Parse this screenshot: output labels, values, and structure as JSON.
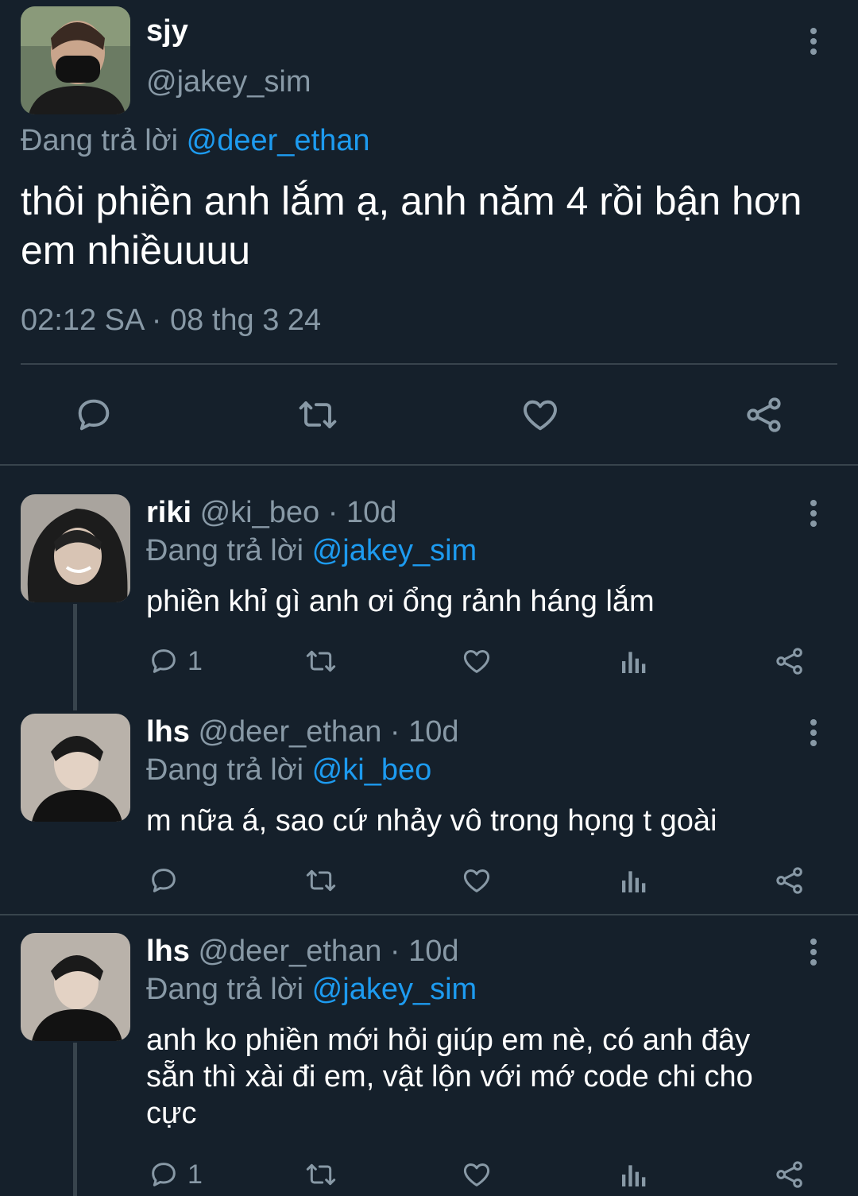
{
  "main_tweet": {
    "display_name": "sjy",
    "handle": "@jakey_sim",
    "reply_prefix": "Đang trả lời",
    "reply_to": "@deer_ethan",
    "text": "thôi phiền anh lắm ạ, anh năm 4 rồi bận hơn em nhiềuuuu",
    "timestamp": "02:12 SA · 08 thg 3 24"
  },
  "replies": [
    {
      "display_name": "riki",
      "handle": "@ki_beo",
      "time": "· 10d",
      "reply_prefix": "Đang trả lời",
      "reply_to": "@jakey_sim",
      "text_lines": [
        "phiền khỉ gì anh ơi ổng rảnh háng lắm"
      ],
      "reply_count": "1"
    },
    {
      "display_name": "lhs",
      "handle": "@deer_ethan",
      "time": "· 10d",
      "reply_prefix": "Đang trả lời",
      "reply_to": "@ki_beo",
      "text_lines": [
        "m nữa á, sao cứ nhảy vô trong họng t goài"
      ],
      "reply_count": ""
    },
    {
      "display_name": "lhs",
      "handle": "@deer_ethan",
      "time": "· 10d",
      "reply_prefix": "Đang trả lời",
      "reply_to": "@jakey_sim",
      "text_lines": [
        "anh ko phiền mới hỏi giúp em nè, có anh đây",
        "sẵn thì xài đi em, vật lộn với mớ code chi cho",
        "cực"
      ],
      "reply_count": "1"
    }
  ],
  "icons": {
    "reply": "reply-icon",
    "retweet": "retweet-icon",
    "like": "heart-icon",
    "views": "views-icon",
    "share": "share-icon",
    "more": "more-vertical-icon"
  },
  "colors": {
    "background": "#15202b",
    "muted": "#8899a6",
    "link": "#1d9bf0",
    "divider": "#38444d"
  }
}
